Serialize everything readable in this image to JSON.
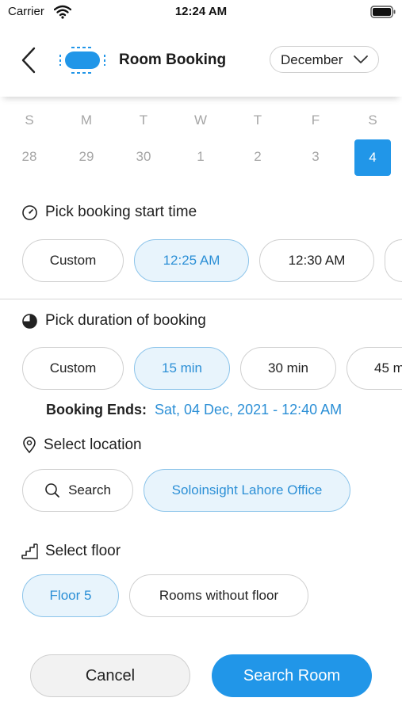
{
  "status_bar": {
    "carrier": "Carrier",
    "time": "12:24 AM"
  },
  "header": {
    "title": "Room Booking",
    "month": "December"
  },
  "week": {
    "day_names": [
      "S",
      "M",
      "T",
      "W",
      "T",
      "F",
      "S"
    ],
    "dates": [
      "28",
      "29",
      "30",
      "1",
      "2",
      "3",
      "4"
    ],
    "selected_index": 6
  },
  "start_time": {
    "title": "Pick booking start time",
    "options": [
      "Custom",
      "12:25 AM",
      "12:30 AM",
      ""
    ],
    "selected": "12:25 AM"
  },
  "duration": {
    "title": "Pick duration of booking",
    "options": [
      "Custom",
      "15 min",
      "30 min",
      "45 m"
    ],
    "selected": "15 min",
    "ends_label": "Booking Ends:",
    "ends_value": "Sat, 04 Dec, 2021 - 12:40 AM"
  },
  "location": {
    "title": "Select location",
    "search_label": "Search",
    "selected": "Soloinsight Lahore Office"
  },
  "floor": {
    "title": "Select floor",
    "options": [
      "Floor 5",
      "Rooms without floor"
    ],
    "selected": "Floor 5"
  },
  "actions": {
    "cancel": "Cancel",
    "search_room": "Search Room"
  },
  "colors": {
    "accent": "#2196e8",
    "accent_light": "#e8f4fc",
    "muted": "#a6a6a6"
  }
}
